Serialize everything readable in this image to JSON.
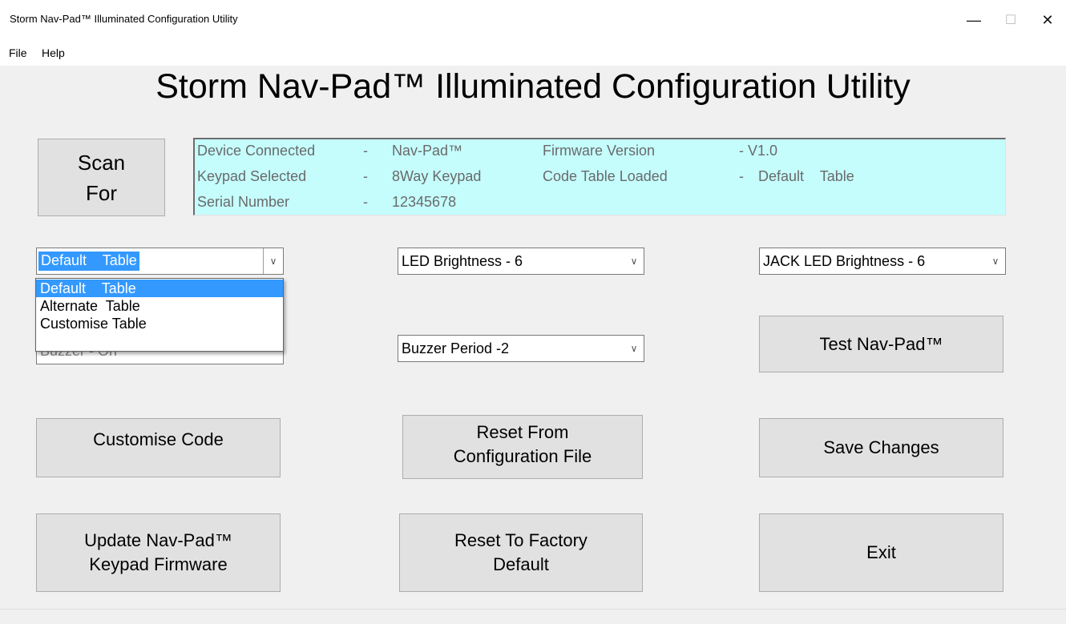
{
  "window": {
    "title": "Storm Nav-Pad™ Illuminated Configuration Utility",
    "minimize_glyph": "—",
    "maximize_glyph": "☐",
    "close_glyph": "✕"
  },
  "menu": {
    "file": "File",
    "help": "Help"
  },
  "app_title": "Storm Nav-Pad™ Illuminated Configuration Utility",
  "scan_button": {
    "line1": "Scan",
    "line2": "For"
  },
  "info": {
    "device_connected_label": "Device Connected",
    "device_connected_sep": "-",
    "device_connected_value": "Nav-Pad™",
    "firmware_label": "Firmware Version",
    "firmware_sep": "- V1.0",
    "keypad_label": "Keypad Selected",
    "keypad_sep": "-",
    "keypad_value": "8Way Keypad",
    "code_table_label": "Code Table Loaded",
    "code_table_sep": "-",
    "code_table_value": "Default    Table",
    "serial_label": "Serial Number",
    "serial_sep": "-",
    "serial_value": "12345678"
  },
  "code_table_combo": {
    "value": "Default    Table",
    "options": [
      "Default    Table",
      "Alternate  Table",
      "Customise Table"
    ],
    "selected_index": 0
  },
  "buzzer_combo_hidden": {
    "value": "Buzzer - On"
  },
  "led_combo": {
    "value": "LED Brightness - 6"
  },
  "buzzer_period_combo": {
    "value": "Buzzer Period -2"
  },
  "jack_led_combo": {
    "value": "JACK LED Brightness - 6"
  },
  "buttons": {
    "test": "Test Nav-Pad™",
    "customise_code": "Customise Code",
    "reset_from_config_1": "Reset From",
    "reset_from_config_2": "Configuration File",
    "save_changes": "Save Changes",
    "update_firmware_1": "Update Nav-Pad™",
    "update_firmware_2": "Keypad Firmware",
    "reset_factory_1": "Reset To Factory",
    "reset_factory_2": "Default",
    "exit": "Exit"
  },
  "icons": {
    "dropdown_arrow": "∨"
  },
  "colors": {
    "info_background": "#c5fdfd",
    "selection": "#3399ff",
    "button_face": "#e1e1e1"
  }
}
